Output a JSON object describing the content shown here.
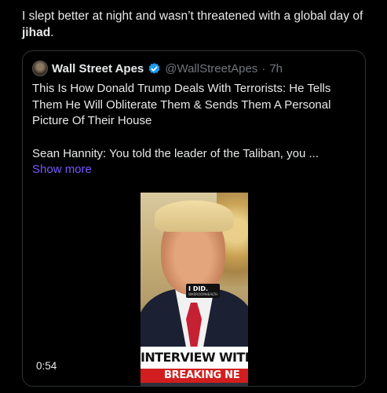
{
  "post": {
    "text_before": "I slept better at night and wasn’t threatened with a global day of ",
    "text_bold": "jihad",
    "text_after": "."
  },
  "quote": {
    "author_name": "Wall Street Apes",
    "handle": "@WallStreetApes",
    "separator": "·",
    "time": "7h",
    "paragraph_1": "This Is How Donald Trump Deals With Terrorists: He Tells Them He Will Obliterate Them & Sends Them A Personal Picture Of Their House",
    "paragraph_2": "Sean Hannity: You told the leader of the Taliban, you ...",
    "show_more": "Show more"
  },
  "video": {
    "duration": "0:54",
    "caption_text": "I DID.",
    "caption_sub": "WARROOMHEALTH",
    "lower_third": "INTERVIEW WITH FM",
    "banner": "BREAKING NE"
  },
  "colors": {
    "background": "#000000",
    "text": "#e7e9ea",
    "muted": "#71767b",
    "link": "#7856ff",
    "verified": "#1d9bf0",
    "banner_red": "#d21e1e"
  },
  "icons": [
    "verified-badge-icon",
    "tiktok-icon",
    "avatar"
  ]
}
